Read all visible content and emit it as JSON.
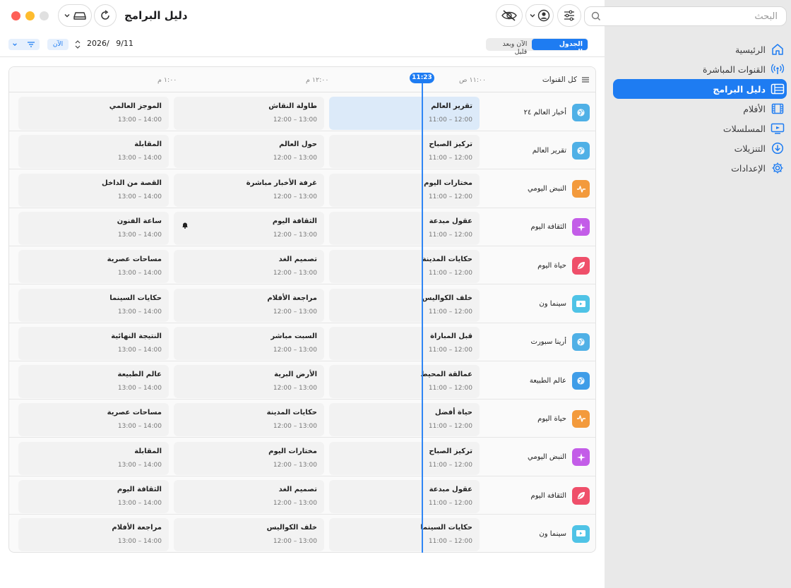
{
  "window": {
    "title": "دليل البرامج"
  },
  "search": {
    "placeholder": "البحث"
  },
  "sidebar": {
    "items": [
      {
        "label": "الرئيسية",
        "icon": "home-icon",
        "active": false
      },
      {
        "label": "القنوات المباشرة",
        "icon": "broadcast-icon",
        "active": false
      },
      {
        "label": "دليل البرامج",
        "icon": "guide-icon",
        "active": true
      },
      {
        "label": "الأفلام",
        "icon": "film-icon",
        "active": false
      },
      {
        "label": "المسلسلات",
        "icon": "tv-icon",
        "active": false
      },
      {
        "label": "التنزيلات",
        "icon": "download-icon",
        "active": false
      },
      {
        "label": "الإعدادات",
        "icon": "gear-icon",
        "active": false
      }
    ]
  },
  "controls": {
    "view_timeline": "الجدول الزمني",
    "view_now_next": "الآن وبعد قليل",
    "date_day": "9/11",
    "date_year": "2026/",
    "now_button": "الآن"
  },
  "guide": {
    "all_channels": "كل القنوات",
    "times": [
      "١١:٠٠ ص",
      "١٢:٠٠ م",
      "١:٠٠ م"
    ],
    "now_time": "11:23",
    "rows": [
      {
        "channel": "أخبار العالم ٢٤",
        "icon": "globe-icon",
        "color": "#4fb0e6",
        "programs": [
          {
            "title": "تقرير العالم",
            "time": "11:00 – 12:00"
          },
          {
            "title": "طاولة النقاش",
            "time": "12:00 – 13:00"
          },
          {
            "title": "الموجز العالمي",
            "time": "13:00 – 14:00"
          }
        ]
      },
      {
        "channel": "تقرير العالم",
        "icon": "globe-icon",
        "color": "#4fb0e6",
        "programs": [
          {
            "title": "تركيز الصباح",
            "time": "11:00 – 12:00"
          },
          {
            "title": "حول العالم",
            "time": "12:00 – 13:00"
          },
          {
            "title": "المقابلة",
            "time": "13:00 – 14:00"
          }
        ]
      },
      {
        "channel": "النبض اليومي",
        "icon": "pulse-icon",
        "color": "#f39a3c",
        "programs": [
          {
            "title": "مختارات اليوم",
            "time": "11:00 – 12:00"
          },
          {
            "title": "غرفة الأخبار مباشرة",
            "time": "12:00 – 13:00"
          },
          {
            "title": "القصة من الداخل",
            "time": "13:00 – 14:00"
          }
        ]
      },
      {
        "channel": "الثقافة اليوم",
        "icon": "sparkle-icon",
        "color": "#c35de8",
        "programs": [
          {
            "title": "عقول مبدعة",
            "time": "11:00 – 12:00"
          },
          {
            "title": "الثقافة اليوم",
            "time": "12:00 – 13:00",
            "bell": true
          },
          {
            "title": "ساعة الفنون",
            "time": "13:00 – 14:00"
          }
        ]
      },
      {
        "channel": "حياة اليوم",
        "icon": "leaf-icon",
        "color": "#ef4f6a",
        "programs": [
          {
            "title": "حكايات المدينة",
            "time": "11:00 – 12:00"
          },
          {
            "title": "تصميم الغد",
            "time": "12:00 – 13:00"
          },
          {
            "title": "مساحات عصرية",
            "time": "13:00 – 14:00"
          }
        ]
      },
      {
        "channel": "سينما ون",
        "icon": "play-icon",
        "color": "#4fc3e6",
        "programs": [
          {
            "title": "خلف الكواليس",
            "time": "11:00 – 12:00"
          },
          {
            "title": "مراجعة الأفلام",
            "time": "12:00 – 13:00"
          },
          {
            "title": "حكايات السينما",
            "time": "13:00 – 14:00"
          }
        ]
      },
      {
        "channel": "أرينا سبورت",
        "icon": "globe-icon",
        "color": "#4fb0e6",
        "programs": [
          {
            "title": "قبل المباراة",
            "time": "11:00 – 12:00"
          },
          {
            "title": "السبت مباشر",
            "time": "12:00 – 13:00"
          },
          {
            "title": "النتيجة النهائية",
            "time": "13:00 – 14:00"
          }
        ]
      },
      {
        "channel": "عالم الطبيعة",
        "icon": "globe-icon",
        "color": "#3f9de8",
        "programs": [
          {
            "title": "عمالقة المحيط",
            "time": "11:00 – 12:00"
          },
          {
            "title": "الأرض البرية",
            "time": "12:00 – 13:00"
          },
          {
            "title": "عالم الطبيعة",
            "time": "13:00 – 14:00"
          }
        ]
      },
      {
        "channel": "حياة اليوم",
        "icon": "pulse-icon",
        "color": "#f39a3c",
        "programs": [
          {
            "title": "حياة أفضل",
            "time": "11:00 – 12:00"
          },
          {
            "title": "حكايات المدينة",
            "time": "12:00 – 13:00"
          },
          {
            "title": "مساحات عصرية",
            "time": "13:00 – 14:00"
          }
        ]
      },
      {
        "channel": "النبض اليومي",
        "icon": "sparkle-icon",
        "color": "#c35de8",
        "programs": [
          {
            "title": "تركيز الصباح",
            "time": "11:00 – 12:00"
          },
          {
            "title": "مختارات اليوم",
            "time": "12:00 – 13:00"
          },
          {
            "title": "المقابلة",
            "time": "13:00 – 14:00"
          }
        ]
      },
      {
        "channel": "الثقافة اليوم",
        "icon": "leaf-icon",
        "color": "#ef4f6a",
        "programs": [
          {
            "title": "عقول مبدعة",
            "time": "11:00 – 12:00"
          },
          {
            "title": "تصميم الغد",
            "time": "12:00 – 13:00"
          },
          {
            "title": "الثقافة اليوم",
            "time": "13:00 – 14:00"
          }
        ]
      },
      {
        "channel": "سينما ون",
        "icon": "play-icon",
        "color": "#4fc3e6",
        "programs": [
          {
            "title": "حكايات السينما",
            "time": "11:00 – 12:00"
          },
          {
            "title": "خلف الكواليس",
            "time": "12:00 – 13:00"
          },
          {
            "title": "مراجعة الأفلام",
            "time": "13:00 – 14:00"
          }
        ]
      }
    ]
  }
}
